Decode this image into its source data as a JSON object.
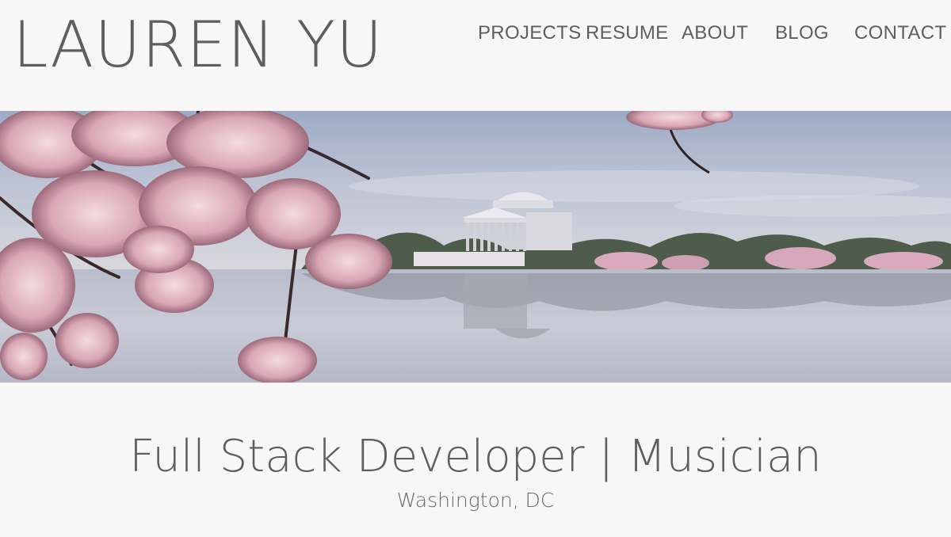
{
  "header": {
    "site_title": "LAUREN YU"
  },
  "nav": {
    "items": [
      {
        "label": "PROJECTS"
      },
      {
        "label": "RESUME"
      },
      {
        "label": "ABOUT"
      },
      {
        "label": "BLOG"
      },
      {
        "label": "CONTACT"
      }
    ]
  },
  "hero": {
    "image_subject": "cherry-blossoms-jefferson-memorial-tidal-basin"
  },
  "intro": {
    "tagline": "Full Stack Developer | Musician",
    "location": "Washington, DC"
  },
  "colors": {
    "background": "#f7f7f8",
    "text": "#5e5e5e",
    "sky": "#aeb8cf",
    "water": "#c8ccd6",
    "blossom": "#e6bfca"
  }
}
